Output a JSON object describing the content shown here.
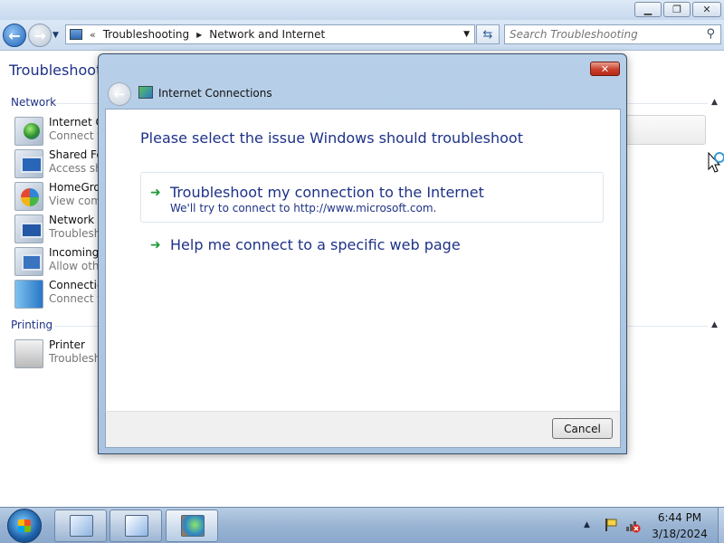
{
  "explorer": {
    "address": {
      "overflow": "«",
      "crumbs": [
        "Troubleshooting",
        "Network and Internet"
      ]
    },
    "search_placeholder": "Search Troubleshooting",
    "page_title": "Troubleshoot p",
    "groups": [
      {
        "heading": "Network",
        "items": [
          {
            "name": "Internet C",
            "desc": "Connect to"
          },
          {
            "name": "Shared Fol",
            "desc": "Access sha"
          },
          {
            "name": "HomeGro",
            "desc": "View comp"
          },
          {
            "name": "Network A",
            "desc": "Troublesh"
          },
          {
            "name": "Incoming",
            "desc": "Allow othe"
          },
          {
            "name": "Connectio",
            "desc": "Connect to"
          }
        ]
      },
      {
        "heading": "Printing",
        "items": [
          {
            "name": "Printer",
            "desc": "Troublesh"
          }
        ]
      }
    ]
  },
  "dialog": {
    "title": "Internet Connections",
    "heading": "Please select the issue Windows should troubleshoot",
    "options": [
      {
        "title": "Troubleshoot my connection to the Internet",
        "subtitle": "We'll try to connect to http://www.microsoft.com."
      },
      {
        "title": "Help me connect to a specific web page"
      }
    ],
    "cancel_label": "Cancel"
  },
  "taskbar": {
    "time": "6:44 PM",
    "date": "3/18/2024",
    "apps": [
      "notepad-icon",
      "control-panel-icon",
      "troubleshooting-icon"
    ]
  }
}
